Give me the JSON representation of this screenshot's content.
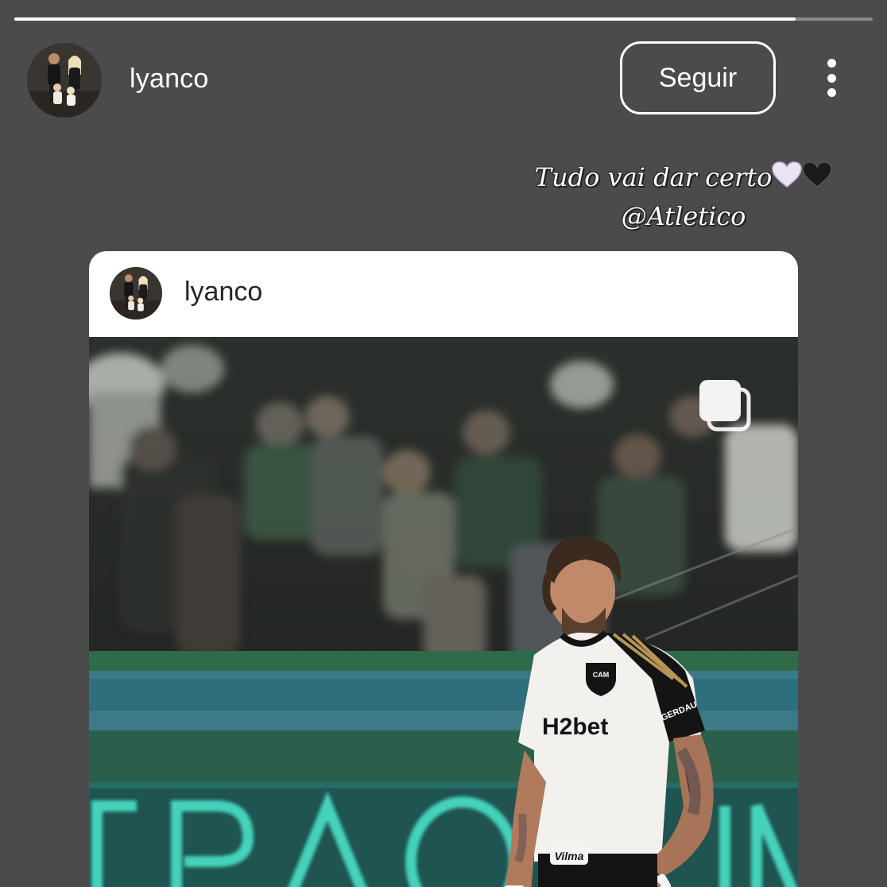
{
  "story": {
    "progress": 0.91,
    "username": "lyanco",
    "follow_label": "Seguir",
    "more_icon": "more-vertical-icon"
  },
  "caption": {
    "line1": "Tudo vai dar certo",
    "line2": "@Atletico",
    "hearts": [
      "white-heart-icon",
      "black-heart-icon"
    ]
  },
  "shared_post": {
    "username": "lyanco",
    "multi_icon": "carousel-icon",
    "jersey_sponsor": "H2bet",
    "sleeve_sponsor": "GERDAU",
    "shorts_sponsor": "Vilma",
    "banner_text": "ERAO"
  },
  "colors": {
    "background": "#4b4b4b",
    "card_header": "#ffffff",
    "pitch_green": "#2f7a62",
    "banner_cyan": "#49e0c8"
  }
}
